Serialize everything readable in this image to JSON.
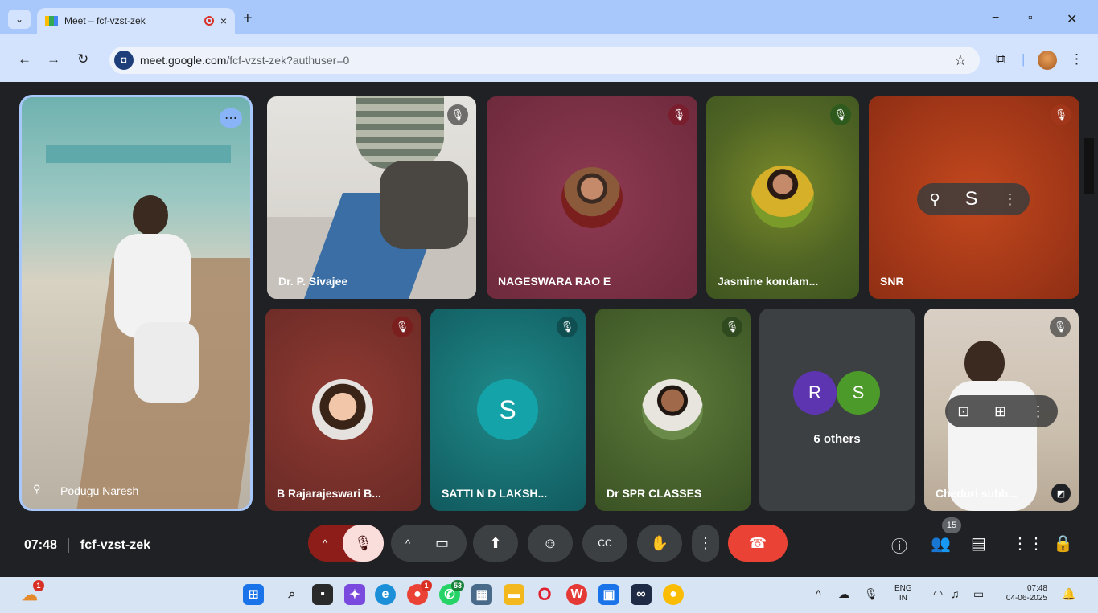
{
  "browser": {
    "tab_title": "Meet – fcf-vzst-zek",
    "tab_close": "×",
    "new_tab": "+",
    "url_host": "meet.google.com",
    "url_path": "/fcf-vzst-zek?authuser=0",
    "minimize": "−",
    "restore": "▫",
    "close": "✕"
  },
  "participants": {
    "featured": {
      "name": "Podugu Naresh"
    },
    "tiles": [
      {
        "name": "Dr. P. Sivajee"
      },
      {
        "name": "NAGESWARA RAO E"
      },
      {
        "name": "Jasmine kondam..."
      },
      {
        "name": "SNR"
      },
      {
        "name": "B Rajarajeswari B..."
      },
      {
        "name": "SATTI N D LAKSH...",
        "initial": "S"
      },
      {
        "name": "Dr SPR CLASSES"
      },
      {
        "name": "Cheduri subb..."
      }
    ],
    "others": {
      "label": "6 others",
      "initials": [
        "R",
        "S"
      ]
    }
  },
  "meeting": {
    "time": "07:48",
    "code": "fcf-vzst-zek",
    "people_count": "15"
  },
  "taskbar": {
    "notification_count": "1",
    "chrome_badge": "1",
    "whatsapp_badge": "53",
    "language": "ENG",
    "region": "IN",
    "clock_time": "07:48",
    "clock_date": "04-06-2025"
  },
  "colors": {
    "tab_strip": "#a8c7fa",
    "toolbar": "#d3e3fd",
    "meet_bg": "#202124",
    "end_call": "#ea4335",
    "mute_red": "#f9dedc"
  }
}
